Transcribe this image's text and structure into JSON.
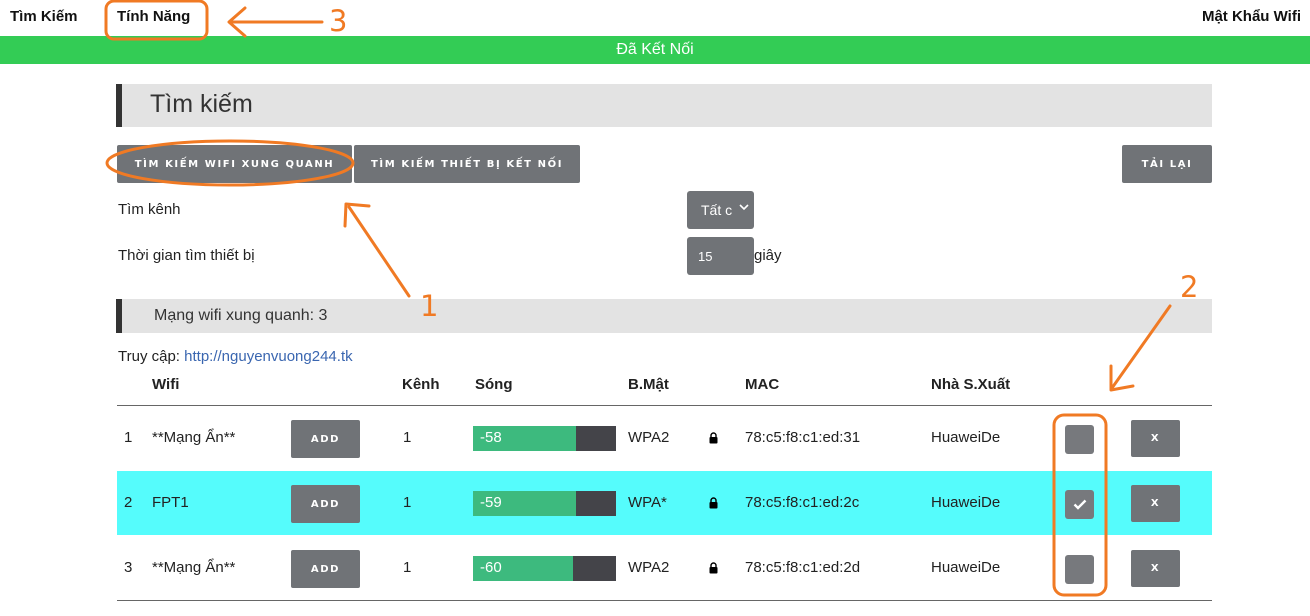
{
  "nav": {
    "search": "Tìm Kiếm",
    "features": "Tính Năng",
    "wifi_password": "Mật Khẩu Wifi"
  },
  "status": {
    "text": "Đã Kết Nối",
    "color": "#33cc55"
  },
  "search_section": {
    "title": "Tìm kiếm"
  },
  "buttons": {
    "scan_wifi": "Tìm kiếm wifi xung quanh",
    "scan_devices": "Tìm kiếm thiết bị kết nối",
    "reload": "Tải lại"
  },
  "form": {
    "channel_label": "Tìm kênh",
    "channel_value": "Tất c",
    "time_label": "Thời gian tìm thiết bị",
    "time_value": "15",
    "time_unit": "giây"
  },
  "wifi_section": {
    "title": "Mạng wifi xung quanh: 3"
  },
  "access": {
    "label": "Truy cập:",
    "link": "http://nguyenvuong244.tk"
  },
  "table": {
    "headers": {
      "wifi": "Wifi",
      "channel": "Kênh",
      "signal": "Sóng",
      "security": "B.Mật",
      "mac": "MAC",
      "vendor": "Nhà S.Xuất"
    },
    "add_label": "ADD",
    "remove_label": "x",
    "rows": [
      {
        "index": "1",
        "ssid": "**Mạng Ẩn**",
        "channel": "1",
        "rssi": "-58",
        "signal_pct": 0.72,
        "security": "WPA2",
        "mac": "78:c5:f8:c1:ed:31",
        "vendor": "HuaweiDe",
        "checked": false,
        "highlighted": false
      },
      {
        "index": "2",
        "ssid": "FPT1",
        "channel": "1",
        "rssi": "-59",
        "signal_pct": 0.72,
        "security": "WPA*",
        "mac": "78:c5:f8:c1:ed:2c",
        "vendor": "HuaweiDe",
        "checked": true,
        "highlighted": true
      },
      {
        "index": "3",
        "ssid": "**Mạng Ẩn**",
        "channel": "1",
        "rssi": "-60",
        "signal_pct": 0.7,
        "security": "WPA2",
        "mac": "78:c5:f8:c1:ed:2d",
        "vendor": "HuaweiDe",
        "checked": false,
        "highlighted": false
      }
    ]
  },
  "annotations": {
    "n1": "1",
    "n2": "2",
    "n3": "3",
    "color": "#f07a24"
  },
  "icons": {
    "lock": "lock-icon",
    "check": "check-icon",
    "chevron": "chevron-down-icon"
  }
}
